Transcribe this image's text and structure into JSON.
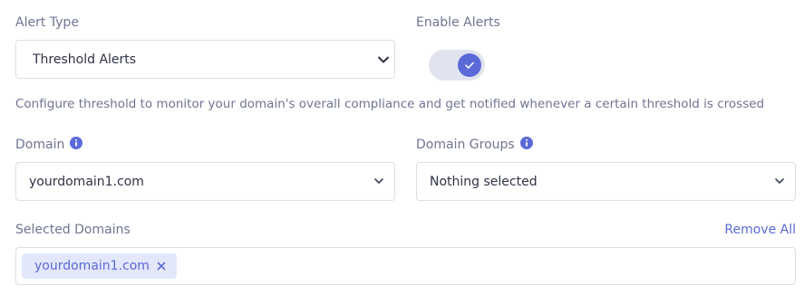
{
  "alert_type": {
    "label": "Alert Type",
    "value": "Threshold Alerts"
  },
  "enable_alerts": {
    "label": "Enable Alerts",
    "enabled": true
  },
  "description": "Configure threshold to monitor your domain's overall compliance and get notified whenever a certain threshold is crossed",
  "domain": {
    "label": "Domain",
    "value": "yourdomain1.com"
  },
  "domain_groups": {
    "label": "Domain Groups",
    "value": "Nothing selected"
  },
  "selected_domains": {
    "label": "Selected Domains",
    "remove_all": "Remove All",
    "chips": [
      "yourdomain1.com"
    ]
  },
  "colors": {
    "accent": "#5b6ad8",
    "chip_bg": "#e3e7fb",
    "label": "#6f7591",
    "border": "#dcdee6"
  },
  "icons": [
    "chevron-down-icon",
    "info-icon",
    "check-icon",
    "close-icon"
  ]
}
